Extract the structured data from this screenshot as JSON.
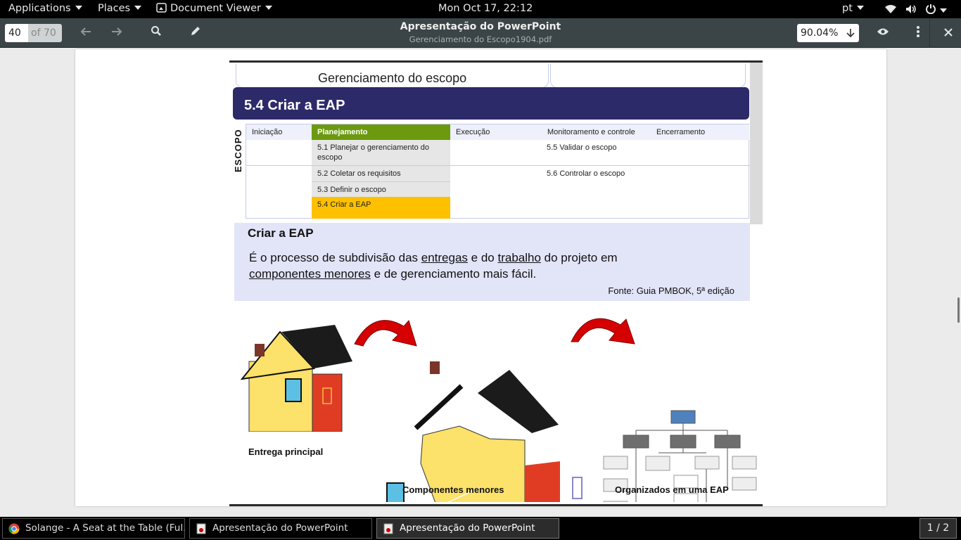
{
  "topbar": {
    "applications": "Applications",
    "places": "Places",
    "app_name": "Document Viewer",
    "clock": "Mon Oct 17, 22:12",
    "keyboard_layout": "pt"
  },
  "headerbar": {
    "page_number": "40",
    "page_total": "of 70",
    "title": "Apresentação do PowerPoint",
    "subtitle": "Gerenciamento do Escopo1904.pdf",
    "zoom": "90.04%"
  },
  "slide": {
    "header": "Gerenciamento do escopo",
    "title": "5.4 Criar a EAP",
    "side_label": "ESCOPO",
    "phases": [
      "Iniciação",
      "Planejamento",
      "Execução",
      "Monitoramento e controle",
      "Encerramento"
    ],
    "planning_items": [
      "5.1 Planejar o gerenciamento do escopo",
      "5.2 Coletar os requisitos",
      "5.3 Definir o escopo",
      "5.4 Criar a EAP"
    ],
    "monitoring_items": [
      "5.5 Validar o escopo",
      "5.6 Controlar o escopo"
    ],
    "definition": {
      "title": "Criar a EAP",
      "text_1": "É o processo de subdivisão das ",
      "text_entregas": "entregas",
      "text_2": " e do ",
      "text_trabalho": "trabalho",
      "text_3": " do projeto em",
      "text_componentes": "componentes menores",
      "text_4": " e de gerenciamento mais fácil.",
      "source": "Fonte: Guia PMBOK, 5ª edição"
    },
    "captions": {
      "main": "Entrega principal",
      "components": "Componentes menores",
      "wbs": "Organizados em uma EAP"
    }
  },
  "taskbar": {
    "tasks": [
      "Solange - A Seat at the Table (Ful...",
      "Apresentação do PowerPoint",
      "Apresentação do PowerPoint"
    ],
    "workspace": "1 / 2"
  },
  "colors": {
    "title_band": "#2d2a6a",
    "planning_header": "#6b9a0e",
    "current_process": "#ffc000",
    "definition_bg": "#e2e4f8",
    "arrow_red": "#d50000"
  }
}
